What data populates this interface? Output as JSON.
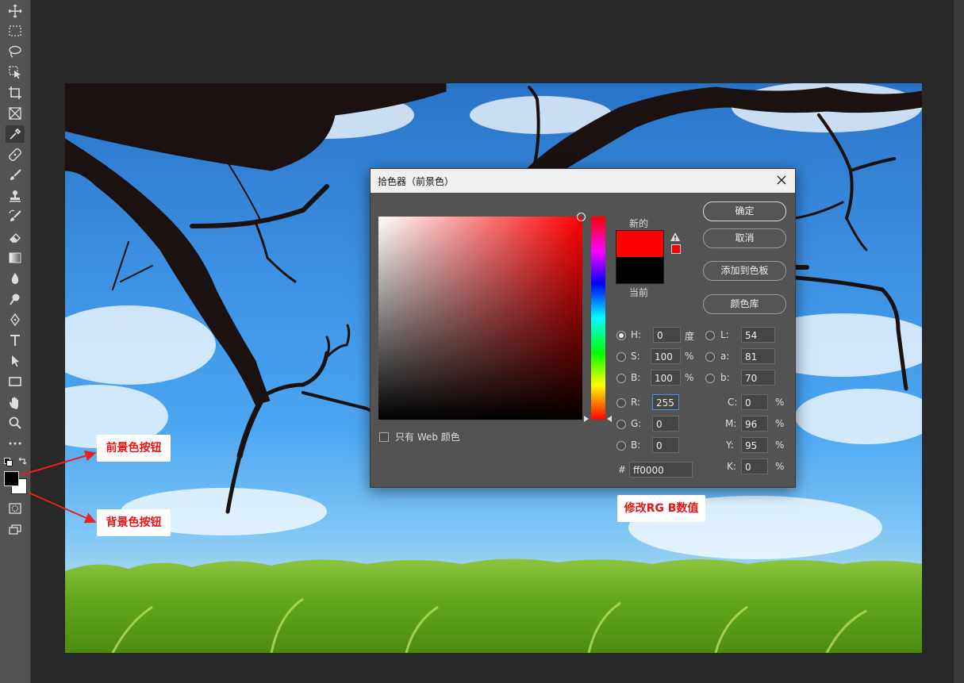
{
  "dialog": {
    "title": "拾色器（前景色）",
    "label_new": "新的",
    "label_current": "当前",
    "web_only_label": "只有 Web 颜色",
    "buttons": {
      "ok": "确定",
      "cancel": "取消",
      "add_swatch": "添加到色板",
      "color_libraries": "颜色库"
    },
    "new_color": "#ff0000",
    "current_color": "#000000",
    "fields": {
      "H": {
        "label": "H:",
        "value": "0",
        "unit": "度"
      },
      "S": {
        "label": "S:",
        "value": "100",
        "unit": "%"
      },
      "B": {
        "label": "B:",
        "value": "100",
        "unit": "%"
      },
      "R": {
        "label": "R:",
        "value": "255"
      },
      "G": {
        "label": "G:",
        "value": "0"
      },
      "Bl": {
        "label": "B:",
        "value": "0"
      },
      "L": {
        "label": "L:",
        "value": "54"
      },
      "a": {
        "label": "a:",
        "value": "81"
      },
      "b": {
        "label": "b:",
        "value": "70"
      },
      "C": {
        "label": "C:",
        "value": "0",
        "unit": "%"
      },
      "M": {
        "label": "M:",
        "value": "96",
        "unit": "%"
      },
      "Y": {
        "label": "Y:",
        "value": "95",
        "unit": "%"
      },
      "K": {
        "label": "K:",
        "value": "0",
        "unit": "%"
      },
      "hex": {
        "label": "#",
        "value": "ff0000"
      }
    }
  },
  "annotations": {
    "foreground": "前景色按钮",
    "background": "背景色按钮",
    "modify_rgb": "修改RG B数值"
  },
  "colors": {
    "foreground": "#000000",
    "background": "#ffffff",
    "annotation_text": "#ee1111"
  }
}
